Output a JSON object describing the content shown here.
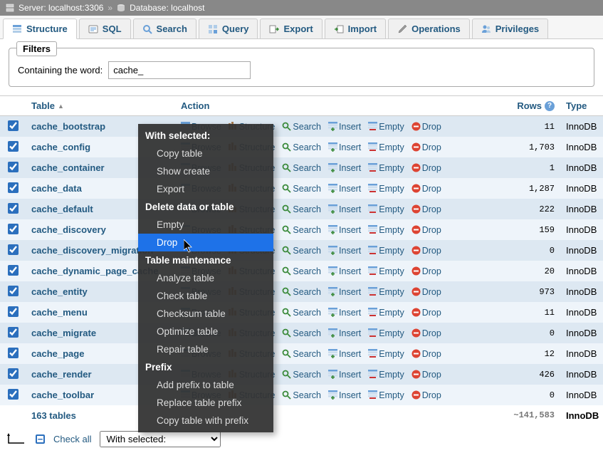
{
  "breadcrumb": {
    "server_label": "Server:",
    "server_value": "localhost:3306",
    "db_label": "Database:",
    "db_value": "localhost"
  },
  "tabs": [
    {
      "id": "structure",
      "label": "Structure",
      "active": true
    },
    {
      "id": "sql",
      "label": "SQL"
    },
    {
      "id": "search",
      "label": "Search"
    },
    {
      "id": "query",
      "label": "Query"
    },
    {
      "id": "export",
      "label": "Export"
    },
    {
      "id": "import",
      "label": "Import"
    },
    {
      "id": "operations",
      "label": "Operations"
    },
    {
      "id": "privileges",
      "label": "Privileges"
    }
  ],
  "filters": {
    "legend": "Filters",
    "label": "Containing the word:",
    "value": "cache_"
  },
  "headers": {
    "table": "Table",
    "action": "Action",
    "rows": "Rows",
    "type": "Type"
  },
  "actions": {
    "browse": "Browse",
    "structure": "Structure",
    "search": "Search",
    "insert": "Insert",
    "empty": "Empty",
    "drop": "Drop"
  },
  "rows": [
    {
      "name": "cache_bootstrap",
      "rows": "11",
      "type": "InnoDB"
    },
    {
      "name": "cache_config",
      "rows": "1,703",
      "type": "InnoDB"
    },
    {
      "name": "cache_container",
      "rows": "1",
      "type": "InnoDB"
    },
    {
      "name": "cache_data",
      "rows": "1,287",
      "type": "InnoDB"
    },
    {
      "name": "cache_default",
      "rows": "222",
      "type": "InnoDB"
    },
    {
      "name": "cache_discovery",
      "rows": "159",
      "type": "InnoDB"
    },
    {
      "name": "cache_discovery_migration",
      "rows": "0",
      "type": "InnoDB"
    },
    {
      "name": "cache_dynamic_page_cache",
      "rows": "20",
      "type": "InnoDB"
    },
    {
      "name": "cache_entity",
      "rows": "973",
      "type": "InnoDB"
    },
    {
      "name": "cache_menu",
      "rows": "11",
      "type": "InnoDB"
    },
    {
      "name": "cache_migrate",
      "rows": "0",
      "type": "InnoDB"
    },
    {
      "name": "cache_page",
      "rows": "12",
      "type": "InnoDB"
    },
    {
      "name": "cache_render",
      "rows": "426",
      "type": "InnoDB"
    },
    {
      "name": "cache_toolbar",
      "rows": "0",
      "type": "InnoDB"
    }
  ],
  "summary": {
    "count_label": "163 tables",
    "total_rows": "~141,583",
    "type": "InnoDB"
  },
  "footer": {
    "check_all": "Check all",
    "with_selected": "With selected:"
  },
  "context_menu": {
    "sections": [
      {
        "header": "With selected:",
        "items": [
          "Copy table",
          "Show create",
          "Export"
        ]
      },
      {
        "header": "Delete data or table",
        "items": [
          "Empty",
          "Drop"
        ],
        "highlight": "Drop"
      },
      {
        "header": "Table maintenance",
        "items": [
          "Analyze table",
          "Check table",
          "Checksum table",
          "Optimize table",
          "Repair table"
        ]
      },
      {
        "header": "Prefix",
        "items": [
          "Add prefix to table",
          "Replace table prefix",
          "Copy table with prefix"
        ]
      }
    ]
  }
}
